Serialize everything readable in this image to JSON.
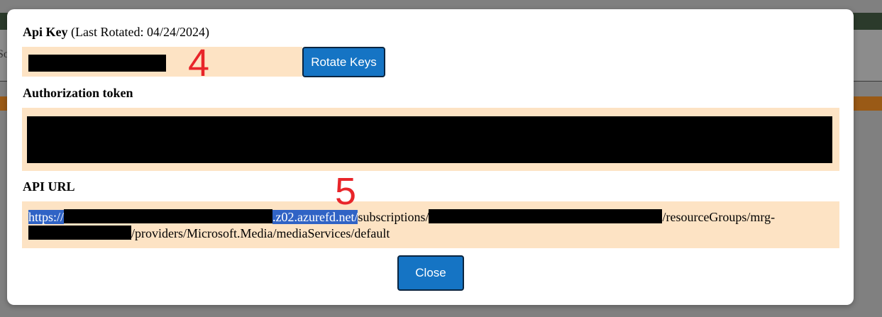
{
  "background": {
    "partial_text": "So"
  },
  "modal": {
    "api_key": {
      "label": "Api Key",
      "rotated_note": "(Last Rotated: 04/24/2024)",
      "rotate_button": "Rotate Keys"
    },
    "auth_token": {
      "label": "Authorization token"
    },
    "api_url": {
      "label": "API URL",
      "part_scheme": "https://",
      "part_host_suffix": ".z02.azurefd.net/",
      "part_subscriptions": "subscriptions/",
      "part_resource_groups": "/resourceGroups/mrg-",
      "part_providers": "/providers/Microsoft.Media/mediaServices/default"
    },
    "close_button": "Close"
  },
  "annotations": {
    "marker_4": "4",
    "marker_5": "5"
  },
  "colors": {
    "panel_bg": "#fde3c4",
    "button_bg": "#1574c4",
    "highlight": "#3063c5",
    "annotation": "#e8252a"
  }
}
